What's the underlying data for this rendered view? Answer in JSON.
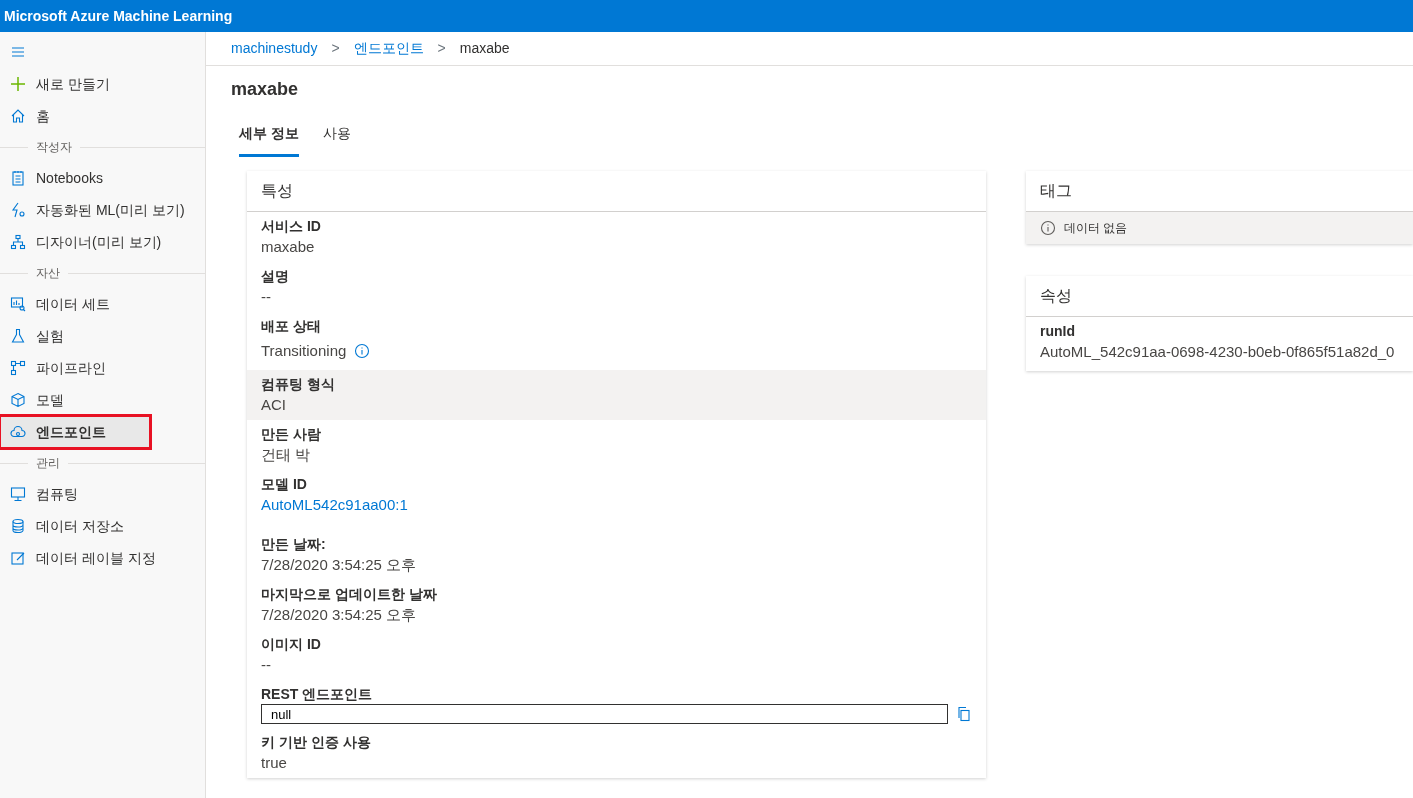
{
  "app_bar": {
    "title": "Microsoft Azure Machine Learning"
  },
  "sidebar": {
    "items": [
      {
        "kind": "action",
        "label": "새로 만들기",
        "selected": false,
        "highlighted": false
      },
      {
        "kind": "item",
        "label": "홈",
        "selected": false,
        "highlighted": false
      },
      {
        "kind": "section",
        "label": "작성자"
      },
      {
        "kind": "item",
        "label": "Notebooks",
        "selected": false,
        "highlighted": false
      },
      {
        "kind": "item",
        "label": "자동화된 ML(미리 보기)",
        "selected": false,
        "highlighted": false
      },
      {
        "kind": "item",
        "label": "디자이너(미리 보기)",
        "selected": false,
        "highlighted": false
      },
      {
        "kind": "section",
        "label": "자산"
      },
      {
        "kind": "item",
        "label": "데이터 세트",
        "selected": false,
        "highlighted": false
      },
      {
        "kind": "item",
        "label": "실험",
        "selected": false,
        "highlighted": false
      },
      {
        "kind": "item",
        "label": "파이프라인",
        "selected": false,
        "highlighted": false
      },
      {
        "kind": "item",
        "label": "모델",
        "selected": false,
        "highlighted": false
      },
      {
        "kind": "item",
        "label": "엔드포인트",
        "selected": true,
        "highlighted": true
      },
      {
        "kind": "section",
        "label": "관리"
      },
      {
        "kind": "item",
        "label": "컴퓨팅",
        "selected": false,
        "highlighted": false
      },
      {
        "kind": "item",
        "label": "데이터 저장소",
        "selected": false,
        "highlighted": false
      },
      {
        "kind": "item",
        "label": "데이터 레이블 지정",
        "selected": false,
        "highlighted": false
      }
    ]
  },
  "breadcrumb": [
    {
      "label": "machinestudy",
      "current": false
    },
    {
      "label": "엔드포인트",
      "current": false
    },
    {
      "label": "maxabe",
      "current": true
    }
  ],
  "breadcrumb_separator": ">",
  "page_title": "maxabe",
  "tabs": [
    {
      "label": "세부 정보",
      "selected": true
    },
    {
      "label": "사용",
      "selected": false
    }
  ],
  "properties_card": {
    "title": "특성",
    "rows": [
      {
        "kind": "text",
        "label": "서비스 ID",
        "value": "maxabe",
        "highlighted": false
      },
      {
        "kind": "text",
        "label": "설명",
        "value": "--",
        "highlighted": false
      },
      {
        "kind": "status",
        "label": "배포 상태",
        "value": "Transitioning",
        "highlighted": false
      },
      {
        "kind": "text",
        "label": "컴퓨팅 형식",
        "value": "ACI",
        "highlighted": true
      },
      {
        "kind": "text",
        "label": "만든 사람",
        "value": "건태 박",
        "highlighted": false
      },
      {
        "kind": "link",
        "label": "모델 ID",
        "value": "AutoML542c91aa00:1",
        "highlighted": false
      },
      {
        "kind": "text",
        "label": "만든 날짜:",
        "value": "7/28/2020 3:54:25 오후",
        "highlighted": false
      },
      {
        "kind": "text",
        "label": "마지막으로 업데이트한 날짜",
        "value": "7/28/2020 3:54:25 오후",
        "highlighted": false
      },
      {
        "kind": "text",
        "label": "이미지 ID",
        "value": "--",
        "highlighted": false
      },
      {
        "kind": "input",
        "label": "REST 엔드포인트",
        "value": "null",
        "highlighted": false
      },
      {
        "kind": "text",
        "label": "키 기반 인증 사용",
        "value": "true",
        "highlighted": false
      }
    ]
  },
  "tags_card": {
    "title": "태그",
    "empty_message": "데이터 없음"
  },
  "attributes_card": {
    "title": "속성",
    "rows": [
      {
        "label": "runId",
        "value": "AutoML_542c91aa-0698-4230-b0eb-0f865f51a82d_0"
      }
    ]
  }
}
